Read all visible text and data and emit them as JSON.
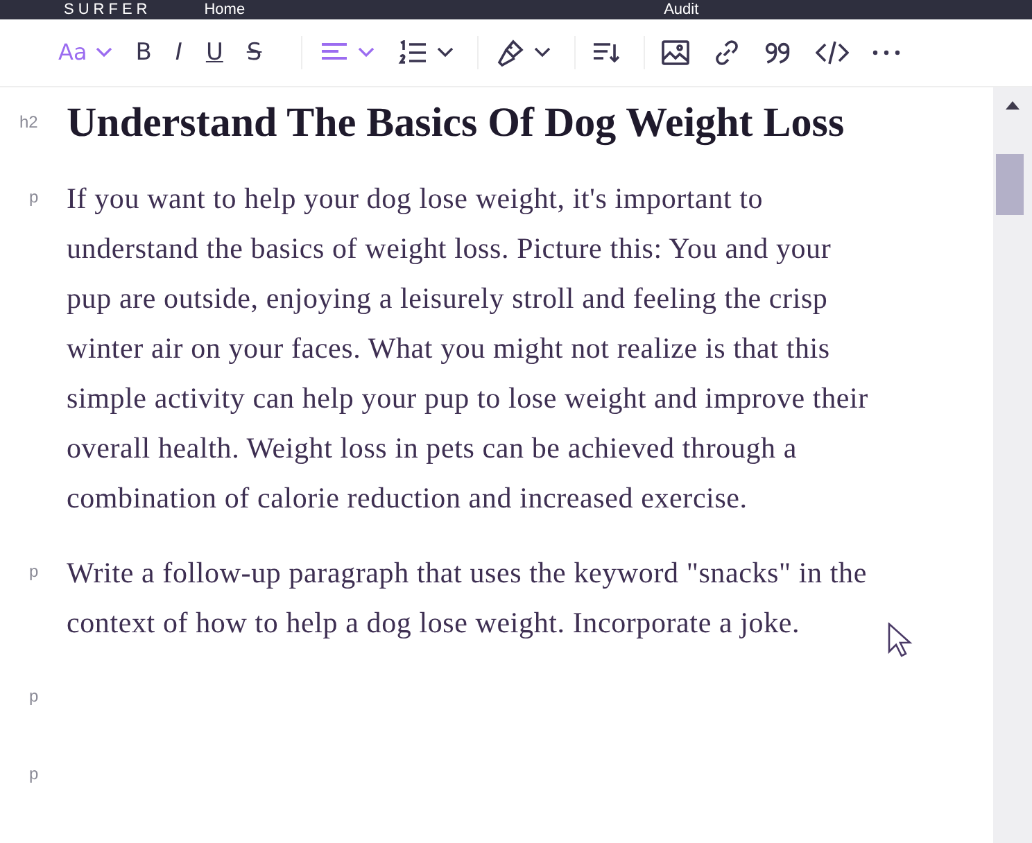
{
  "top_bar": {
    "logo": "SURFER",
    "links": [
      "Home",
      "Audit"
    ]
  },
  "toolbar": [
    {
      "kind": "font",
      "label": "Aa",
      "selected": true,
      "dropdown": true
    },
    {
      "kind": "bold",
      "label": "B",
      "selected": false,
      "dropdown": false
    },
    {
      "kind": "italic",
      "label": "I",
      "selected": false,
      "dropdown": false
    },
    {
      "kind": "underline",
      "label": "U",
      "selected": false,
      "dropdown": false
    },
    {
      "kind": "strike",
      "label": "S",
      "selected": false,
      "dropdown": false
    },
    {
      "kind": "align",
      "selected": true,
      "dropdown": true
    },
    {
      "kind": "list",
      "selected": false,
      "dropdown": true
    },
    {
      "kind": "brush",
      "selected": false,
      "dropdown": true
    },
    {
      "kind": "sort",
      "selected": false,
      "dropdown": false
    },
    {
      "kind": "image",
      "selected": false,
      "dropdown": false
    },
    {
      "kind": "link",
      "selected": false,
      "dropdown": false
    },
    {
      "kind": "quote",
      "selected": false,
      "dropdown": false
    },
    {
      "kind": "code",
      "selected": false,
      "dropdown": false
    },
    {
      "kind": "more",
      "selected": false,
      "dropdown": false
    }
  ],
  "blocks": [
    {
      "tag": "h2",
      "kind": "heading",
      "text": "Understand The Basics Of Dog Weight Loss"
    },
    {
      "tag": "p",
      "kind": "paragraph",
      "text": "If you want to help your dog lose weight, it's important to understand the basics of weight loss. Picture this: You and your pup are outside, enjoying a leisurely stroll and feeling the crisp winter air on your faces. What you might not realize is that this simple activity can help your pup to lose weight and improve their overall health. Weight loss in pets can be achieved through a combination of calorie reduction and increased exercise."
    },
    {
      "tag": "p",
      "kind": "paragraph",
      "text": "Write a follow-up paragraph that uses the keyword \"snacks\" in the context of how to help a dog lose weight. Incorporate a joke."
    },
    {
      "tag": "p",
      "kind": "empty"
    },
    {
      "tag": "p",
      "kind": "empty"
    }
  ]
}
